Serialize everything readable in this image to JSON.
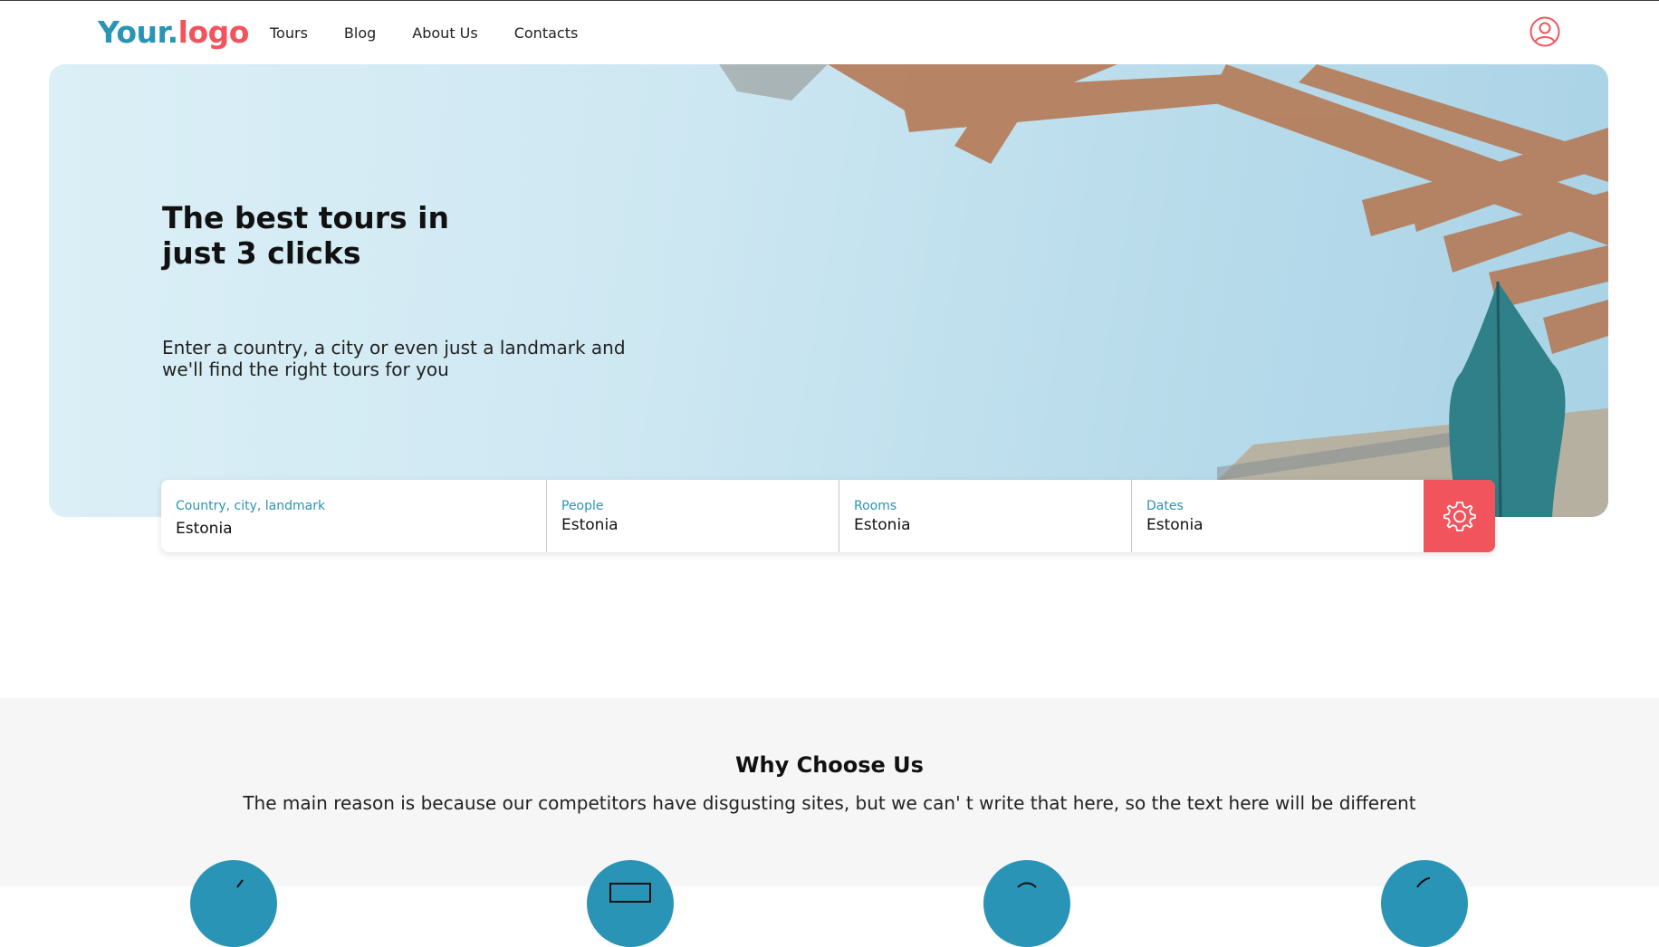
{
  "brand": {
    "logo_part1": "Your.",
    "logo_part2": "logo",
    "primary": "#2a94b6",
    "accent": "#f1545c"
  },
  "nav": {
    "items": [
      "Tours",
      "Blog",
      "About Us",
      "Contacts"
    ]
  },
  "header": {
    "user_icon": "user-icon"
  },
  "hero": {
    "title": "The best tours in just 3 clicks",
    "subtitle": "Enter a country, a city or even just a landmark and we'll find the right tours for you"
  },
  "search": {
    "fields": [
      {
        "label": "Country, city, landmark",
        "value": "Estonia"
      },
      {
        "label": "People",
        "value": "Estonia"
      },
      {
        "label": "Rooms",
        "value": "Estonia"
      },
      {
        "label": "Dates",
        "value": "Estonia"
      }
    ],
    "button_icon": "gear-icon"
  },
  "why": {
    "title": "Why Choose Us",
    "text": "The main reason is because our competitors have disgusting sites, but we can' t write that here, so the text here will be different",
    "feature_icons": [
      "pen-icon",
      "laptop-icon",
      "globe-icon",
      "feather-icon"
    ]
  }
}
